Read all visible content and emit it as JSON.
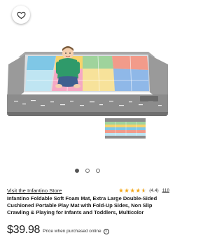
{
  "favorite": {
    "icon": "heart-outline-icon"
  },
  "gallery": {
    "image_count": 3,
    "active_index": 0
  },
  "product": {
    "store_link": "Visit the Infantino Store",
    "rating_value": 4.4,
    "rating_text": "(4.4)",
    "review_count": "118",
    "title": "Infantino Foldable Soft Foam Mat, Extra Large Double-Sided Cushioned Portable Play Mat with Fold-Up Sides, Non Slip Crawling & Playing for Infants and Toddlers, Multicolor",
    "price": "$39.98",
    "price_note": "Price when purchased online",
    "info_icon": "info-icon"
  },
  "colors": {
    "star": "#f3a616",
    "mat_border": "#8c8c8c",
    "text": "#1a1a1a"
  }
}
